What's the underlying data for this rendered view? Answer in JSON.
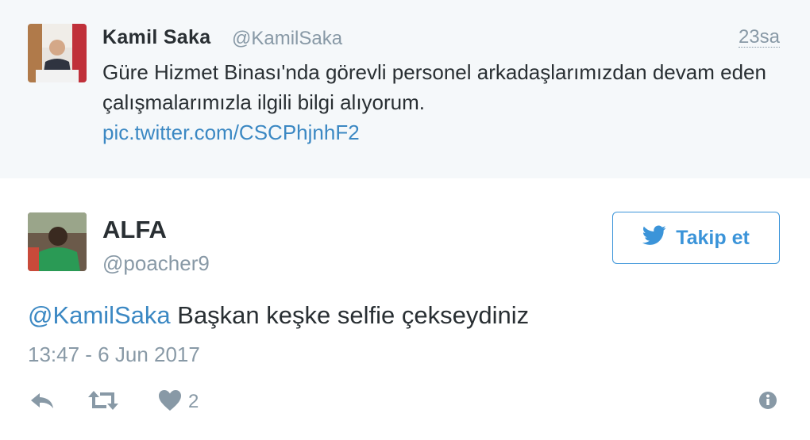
{
  "quoted_tweet": {
    "author_name": "Kamil Saka",
    "author_handle": "@KamilSaka",
    "time": "23sa",
    "text": "Güre Hizmet Binası'nda görevli personel arkadaşlarımızdan devam eden çalışmalarımızla ilgili bilgi alıyorum.",
    "link": "pic.twitter.com/CSCPhjnhF2"
  },
  "main_tweet": {
    "author_name": "ALFA",
    "author_handle": "@poacher9",
    "follow_label": "Takip et",
    "mention": "@KamilSaka",
    "text": " Başkan keşke selfie çekseydiniz",
    "date": "13:47 - 6 Jun 2017"
  },
  "actions": {
    "reply_icon": "reply-icon",
    "retweet_icon": "retweet-icon",
    "like_icon": "heart-icon",
    "like_count": "2",
    "info_icon": "info-icon"
  },
  "colors": {
    "link": "#3b88c3",
    "button": "#3b94d9",
    "muted": "#8899a6",
    "quoted_bg": "#f5f8fa"
  }
}
